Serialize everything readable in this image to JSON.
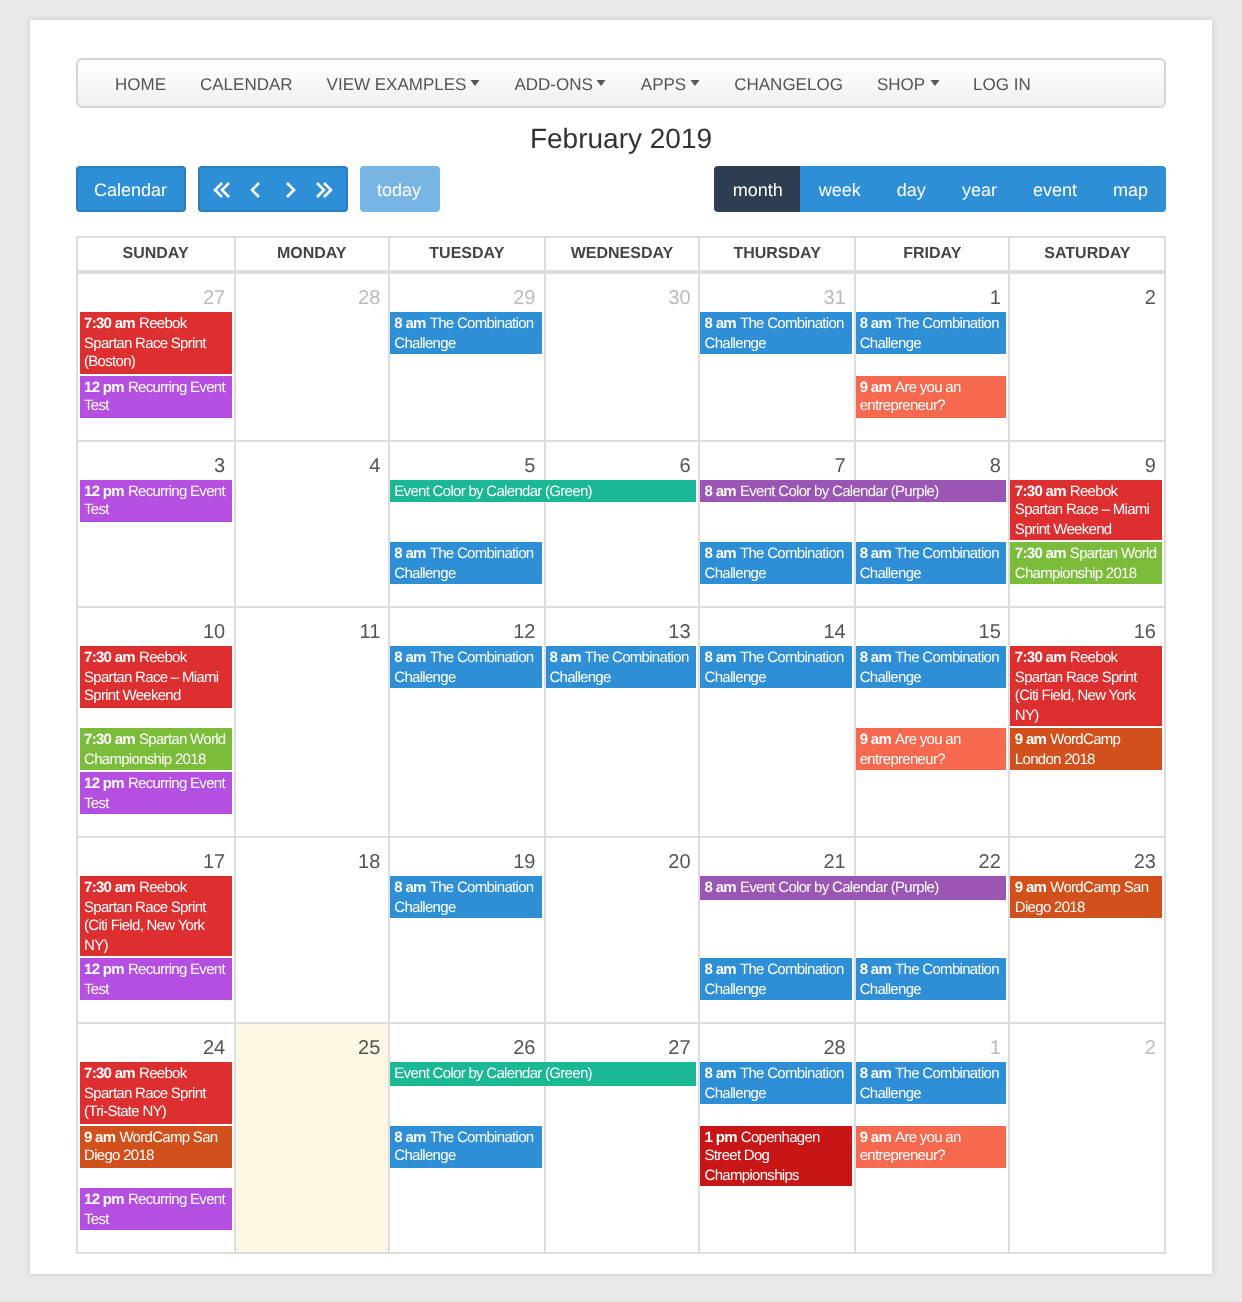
{
  "nav": [
    {
      "label": "HOME",
      "has_menu": false
    },
    {
      "label": "CALENDAR",
      "has_menu": false
    },
    {
      "label": "VIEW EXAMPLES",
      "has_menu": true
    },
    {
      "label": "ADD-ONS",
      "has_menu": true
    },
    {
      "label": "APPS",
      "has_menu": true
    },
    {
      "label": "CHANGELOG",
      "has_menu": false
    },
    {
      "label": "SHOP",
      "has_menu": true
    },
    {
      "label": "LOG IN",
      "has_menu": false
    }
  ],
  "title": "February 2019",
  "toolbar": {
    "calendar_button": "Calendar",
    "today": {
      "label": "today",
      "disabled": true
    },
    "views": [
      {
        "label": "month",
        "selected": true
      },
      {
        "label": "week",
        "selected": false
      },
      {
        "label": "day",
        "selected": false
      },
      {
        "label": "year",
        "selected": false
      },
      {
        "label": "event",
        "selected": false
      },
      {
        "label": "map",
        "selected": false
      }
    ]
  },
  "weekdays": [
    "SUNDAY",
    "MONDAY",
    "TUESDAY",
    "WEDNESDAY",
    "THURSDAY",
    "FRIDAY",
    "SATURDAY"
  ],
  "weeks": [
    {
      "days": [
        {
          "number": "27",
          "other_month": true,
          "today": false,
          "events": [
            {
              "time": "7:30 am",
              "title": "Reebok Spartan Race Sprint (Boston)",
              "color": "#dd2f2f",
              "multi_day": false
            },
            {
              "time": "12 pm",
              "title": "Recurring Event Test",
              "color": "#b54fe2",
              "multi_day": false
            }
          ]
        },
        {
          "number": "28",
          "other_month": true,
          "today": false
        },
        {
          "number": "29",
          "other_month": true,
          "today": false,
          "events": [
            {
              "time": "8 am",
              "title": "The Combination Challenge",
              "color": "#2f8fd6",
              "multi_day": false
            }
          ]
        },
        {
          "number": "30",
          "other_month": true,
          "today": false
        },
        {
          "number": "31",
          "other_month": true,
          "today": false,
          "events": [
            {
              "time": "8 am",
              "title": "The Combination Challenge",
              "color": "#2f8fd6",
              "multi_day": false
            }
          ]
        },
        {
          "number": "1",
          "other_month": false,
          "today": false,
          "events": [
            {
              "time": "8 am",
              "title": "The Combination Challenge",
              "color": "#2f8fd6",
              "multi_day": false
            },
            {
              "time": "9 am",
              "title": "Are you an entrepreneur?",
              "color": "#f7694f",
              "multi_day": false
            }
          ]
        },
        {
          "number": "2",
          "other_month": false,
          "today": false
        }
      ]
    },
    {
      "days": [
        {
          "number": "3",
          "other_month": false,
          "today": false,
          "events": [
            {
              "time": "12 pm",
              "title": "Recurring Event Test",
              "color": "#b54fe2",
              "multi_day": false
            }
          ]
        },
        {
          "number": "4",
          "other_month": false,
          "today": false
        },
        {
          "number": "5",
          "other_month": false,
          "today": false,
          "events": [
            {
              "title": "Event Color by Calendar (Green)",
              "color": "#1ab894",
              "multi_day": true
            },
            {
              "time": "8 am",
              "title": "The Combination Challenge",
              "color": "#2f8fd6",
              "multi_day": false
            }
          ]
        },
        {
          "number": "6",
          "other_month": false,
          "today": false
        },
        {
          "number": "7",
          "other_month": false,
          "today": false,
          "events": [
            {
              "time": "8 am",
              "title": "Event Color by Calendar (Purple)",
              "color": "#9b55b4",
              "multi_day": true
            },
            {
              "time": "8 am",
              "title": "The Combination Challenge",
              "color": "#2f8fd6",
              "multi_day": false
            }
          ]
        },
        {
          "number": "8",
          "other_month": false,
          "today": false,
          "events": [
            {
              "time": "8 am",
              "title": "The Combination Challenge",
              "color": "#2f8fd6",
              "multi_day": false
            }
          ]
        },
        {
          "number": "9",
          "other_month": false,
          "today": false,
          "events": [
            {
              "time": "7:30 am",
              "title": "Reebok Spartan Race – Miami Sprint Weekend",
              "color": "#dd2f2f",
              "multi_day": false
            },
            {
              "time": "7:30 am",
              "title": "Spartan World Championship 2018",
              "color": "#7bbd3a",
              "multi_day": false
            }
          ]
        }
      ]
    },
    {
      "days": [
        {
          "number": "10",
          "other_month": false,
          "today": false,
          "events": [
            {
              "time": "7:30 am",
              "title": "Reebok Spartan Race – Miami Sprint Weekend",
              "color": "#dd2f2f",
              "multi_day": false
            },
            {
              "time": "7:30 am",
              "title": "Spartan World Championship 2018",
              "color": "#7bbd3a",
              "multi_day": false
            },
            {
              "time": "12 pm",
              "title": "Recurring Event Test",
              "color": "#b54fe2",
              "multi_day": false
            }
          ]
        },
        {
          "number": "11",
          "other_month": false,
          "today": false
        },
        {
          "number": "12",
          "other_month": false,
          "today": false,
          "events": [
            {
              "time": "8 am",
              "title": "The Combination Challenge",
              "color": "#2f8fd6",
              "multi_day": false
            }
          ]
        },
        {
          "number": "13",
          "other_month": false,
          "today": false,
          "events": [
            {
              "time": "8 am",
              "title": "The Combination Challenge",
              "color": "#2f8fd6",
              "multi_day": false
            }
          ]
        },
        {
          "number": "14",
          "other_month": false,
          "today": false,
          "events": [
            {
              "time": "8 am",
              "title": "The Combination Challenge",
              "color": "#2f8fd6",
              "multi_day": false
            }
          ]
        },
        {
          "number": "15",
          "other_month": false,
          "today": false,
          "events": [
            {
              "time": "8 am",
              "title": "The Combination Challenge",
              "color": "#2f8fd6",
              "multi_day": false
            },
            {
              "time": "9 am",
              "title": "Are you an entrepreneur?",
              "color": "#f7694f",
              "multi_day": false
            }
          ]
        },
        {
          "number": "16",
          "other_month": false,
          "today": false,
          "events": [
            {
              "time": "7:30 am",
              "title": "Reebok Spartan Race Sprint (Citi Field, New York NY)",
              "color": "#dd2f2f",
              "multi_day": false
            },
            {
              "time": "9 am",
              "title": "WordCamp London 2018",
              "color": "#d2501c",
              "multi_day": false
            }
          ]
        }
      ]
    },
    {
      "days": [
        {
          "number": "17",
          "other_month": false,
          "today": false,
          "events": [
            {
              "time": "7:30 am",
              "title": "Reebok Spartan Race Sprint (Citi Field, New York NY)",
              "color": "#dd2f2f",
              "multi_day": false
            },
            {
              "time": "12 pm",
              "title": "Recurring Event Test",
              "color": "#b54fe2",
              "multi_day": false
            }
          ]
        },
        {
          "number": "18",
          "other_month": false,
          "today": false
        },
        {
          "number": "19",
          "other_month": false,
          "today": false,
          "events": [
            {
              "time": "8 am",
              "title": "The Combination Challenge",
              "color": "#2f8fd6",
              "multi_day": false
            }
          ]
        },
        {
          "number": "20",
          "other_month": false,
          "today": false
        },
        {
          "number": "21",
          "other_month": false,
          "today": false,
          "events": [
            {
              "time": "8 am",
              "title": "Event Color by Calendar (Purple)",
              "color": "#9b55b4",
              "multi_day": true
            },
            {
              "time": "8 am",
              "title": "The Combination Challenge",
              "color": "#2f8fd6",
              "multi_day": false
            }
          ]
        },
        {
          "number": "22",
          "other_month": false,
          "today": false,
          "events": [
            {
              "time": "8 am",
              "title": "The Combination Challenge",
              "color": "#2f8fd6",
              "multi_day": false
            }
          ]
        },
        {
          "number": "23",
          "other_month": false,
          "today": false,
          "events": [
            {
              "time": "9 am",
              "title": "WordCamp San Diego 2018",
              "color": "#d2501c",
              "multi_day": false
            }
          ]
        }
      ]
    },
    {
      "days": [
        {
          "number": "24",
          "other_month": false,
          "today": false,
          "events": [
            {
              "time": "7:30 am",
              "title": "Reebok Spartan Race Sprint (Tri-State NY)",
              "color": "#dd2f2f",
              "multi_day": false
            },
            {
              "time": "9 am",
              "title": "WordCamp San Diego 2018",
              "color": "#d2501c",
              "multi_day": false
            },
            {
              "time": "12 pm",
              "title": "Recurring Event Test",
              "color": "#b54fe2",
              "multi_day": false
            }
          ]
        },
        {
          "number": "25",
          "other_month": false,
          "today": true
        },
        {
          "number": "26",
          "other_month": false,
          "today": false,
          "events": [
            {
              "title": "Event Color by Calendar (Green)",
              "color": "#1ab894",
              "multi_day": true
            },
            {
              "time": "8 am",
              "title": "The Combination Challenge",
              "color": "#2f8fd6",
              "multi_day": false
            }
          ]
        },
        {
          "number": "27",
          "other_month": false,
          "today": false
        },
        {
          "number": "28",
          "other_month": false,
          "today": false,
          "events": [
            {
              "time": "8 am",
              "title": "The Combination Challenge",
              "color": "#2f8fd6",
              "multi_day": false
            },
            {
              "time": "1 pm",
              "title": "Copenhagen Street Dog Championships",
              "color": "#c81515",
              "multi_day": false
            }
          ]
        },
        {
          "number": "1",
          "other_month": true,
          "today": false,
          "events": [
            {
              "time": "8 am",
              "title": "The Combination Challenge",
              "color": "#2f8fd6",
              "multi_day": false
            },
            {
              "time": "9 am",
              "title": "Are you an entrepreneur?",
              "color": "#f7694f",
              "multi_day": false
            }
          ]
        },
        {
          "number": "2",
          "other_month": true,
          "today": false
        }
      ]
    }
  ]
}
